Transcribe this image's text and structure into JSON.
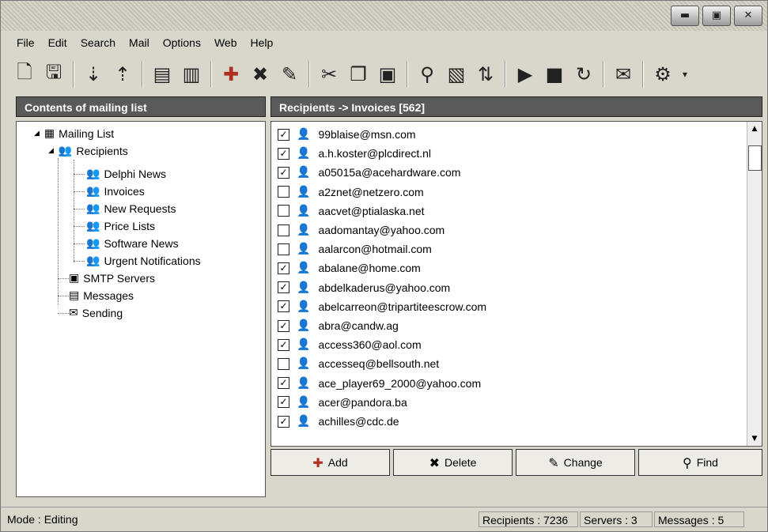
{
  "window": {
    "buttons": [
      "▬",
      "▣",
      "✕"
    ]
  },
  "menu": [
    {
      "label": "File",
      "icon": null
    },
    {
      "label": "Edit"
    },
    {
      "label": "Search"
    },
    {
      "label": "Mail"
    },
    {
      "label": "Options"
    },
    {
      "label": "Web"
    },
    {
      "label": "Help"
    }
  ],
  "toolbar": {
    "icons": [
      "new-icon",
      "save-icon",
      "import-icon",
      "export-icon",
      "db-icon",
      "book-icon",
      "add-icon",
      "delete-icon",
      "edit-icon",
      "cut-icon",
      "copy-icon",
      "paste-icon",
      "search-icon",
      "find-doc-icon",
      "sort-icon",
      "play-icon",
      "stop-icon",
      "refresh-icon",
      "mail-icon",
      "settings-icon"
    ]
  },
  "left_panel": {
    "title": "Contents of mailing list"
  },
  "right_panel": {
    "title": "Recipients -> Invoices [562]"
  },
  "tree": {
    "root": "Mailing List",
    "recipients": "Recipients",
    "children": [
      "Delphi News",
      "Invoices",
      "New Requests",
      "Price Lists",
      "Software News",
      "Urgent Notifications"
    ],
    "smtp": "SMTP Servers",
    "messages": "Messages",
    "sending": "Sending"
  },
  "recipients": [
    {
      "email": "99blaise@msn.com",
      "checked": "✓"
    },
    {
      "email": "a.h.koster@plcdirect.nl",
      "checked": "✓"
    },
    {
      "email": "a05015a@acehardware.com",
      "checked": "✓"
    },
    {
      "email": "a2znet@netzero.com",
      "checked": ""
    },
    {
      "email": "aacvet@ptialaska.net",
      "checked": ""
    },
    {
      "email": "aadomantay@yahoo.com",
      "checked": ""
    },
    {
      "email": "aalarcon@hotmail.com",
      "checked": ""
    },
    {
      "email": "abalane@home.com",
      "checked": "✓"
    },
    {
      "email": "abdelkaderus@yahoo.com",
      "checked": "✓"
    },
    {
      "email": "abelcarreon@tripartiteescrow.com",
      "checked": "✓"
    },
    {
      "email": "abra@candw.ag",
      "checked": "✓"
    },
    {
      "email": "access360@aol.com",
      "checked": "✓"
    },
    {
      "email": "accesseq@bellsouth.net",
      "checked": ""
    },
    {
      "email": "ace_player69_2000@yahoo.com",
      "checked": "✓"
    },
    {
      "email": "acer@pandora.ba",
      "checked": "✓"
    },
    {
      "email": "achilles@cdc.de",
      "checked": "✓"
    }
  ],
  "buttons": {
    "add": "Add",
    "delete": "Delete",
    "change": "Change",
    "find": "Find"
  },
  "status": {
    "mode": "Mode : Editing",
    "recipients": "Recipients : 7236",
    "servers": "Servers : 3",
    "messages": "Messages : 5"
  }
}
